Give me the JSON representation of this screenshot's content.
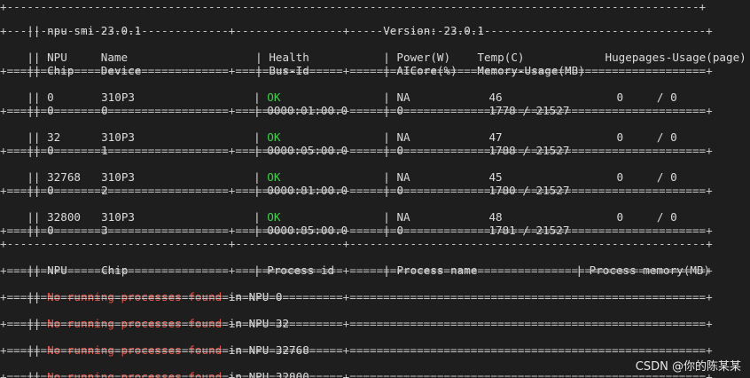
{
  "header": {
    "tool": "npu-smi 23.0.1",
    "version": "Version: 23.0.1"
  },
  "columns": {
    "npu": "NPU",
    "name": "Name",
    "chip": "Chip",
    "device": "Device",
    "health": "Health",
    "bus_id": "Bus-Id",
    "power": "Power(W)",
    "aicore": "AICore(%)",
    "temp": "Temp(C)",
    "memory_usage": "Memory-Usage(MB)",
    "hugepages": "Hugepages-Usage(page)"
  },
  "devices": [
    {
      "npu": "0",
      "name": "310P3",
      "health": "OK",
      "power": "NA",
      "temp": "46",
      "hugepages": "0     / 0",
      "chip": "0",
      "device": "0",
      "bus_id": "0000:01:00.0",
      "aicore": "0",
      "memory": "1778 / 21527"
    },
    {
      "npu": "32",
      "name": "310P3",
      "health": "OK",
      "power": "NA",
      "temp": "47",
      "hugepages": "0     / 0",
      "chip": "0",
      "device": "1",
      "bus_id": "0000:05:00.0",
      "aicore": "0",
      "memory": "1788 / 21527"
    },
    {
      "npu": "32768",
      "name": "310P3",
      "health": "OK",
      "power": "NA",
      "temp": "45",
      "hugepages": "0     / 0",
      "chip": "0",
      "device": "2",
      "bus_id": "0000:81:00.0",
      "aicore": "0",
      "memory": "1780 / 21527"
    },
    {
      "npu": "32800",
      "name": "310P3",
      "health": "OK",
      "power": "NA",
      "temp": "48",
      "hugepages": "0     / 0",
      "chip": "0",
      "device": "3",
      "bus_id": "0000:85:00.0",
      "aicore": "0",
      "memory": "1781 / 21527"
    }
  ],
  "process_columns": {
    "npu": "NPU",
    "chip": "Chip",
    "process_id": "Process id",
    "process_name": "Process name",
    "process_memory": "Process memory(MB)"
  },
  "processes": [
    {
      "message": "No running processes found",
      "suffix": " in NPU 0"
    },
    {
      "message": "No running processes found",
      "suffix": " in NPU 32"
    },
    {
      "message": "No running processes found",
      "suffix": " in NPU 32768"
    },
    {
      "message": "No running processes found",
      "suffix": " in NPU 32800"
    }
  ],
  "watermark": "CSDN @你的陈某某",
  "colors": {
    "background": "#1e1e1e",
    "text": "#dcdcdc",
    "ok": "#3fd04a",
    "error": "#e8564a"
  }
}
